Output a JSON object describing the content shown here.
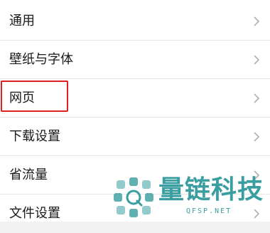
{
  "settings": {
    "items": [
      {
        "label": "通用"
      },
      {
        "label": "壁纸与字体"
      },
      {
        "label": "网页"
      },
      {
        "label": "下载设置"
      },
      {
        "label": "省流量"
      },
      {
        "label": "文件设置"
      }
    ]
  },
  "watermark": {
    "brand_name": "量链科技",
    "url": "QFSP.NET"
  },
  "colors": {
    "highlight": "#e02020",
    "watermark": "#3a9ea0",
    "divider": "#e6e6e6",
    "chevron": "#b0b0b0"
  }
}
